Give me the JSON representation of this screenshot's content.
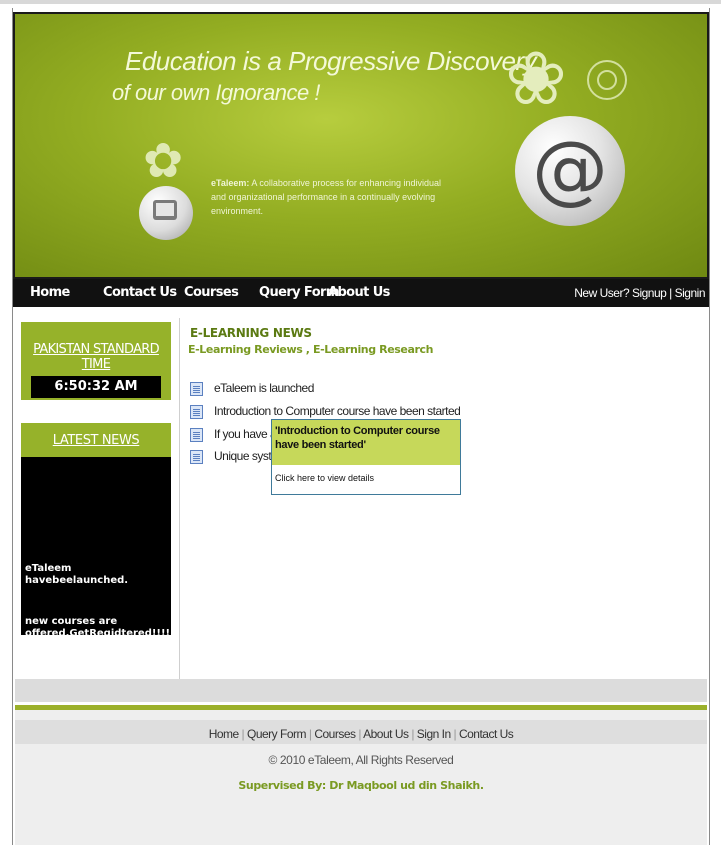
{
  "header": {
    "headline_line1": "Education is a Progressive Discovery",
    "headline_line2": "of our own Ignorance !",
    "brand": "eTaleem:",
    "tagline": "A collaborative process for enhancing individual and organizational performance in a continually evolving environment.",
    "at_symbol": "@"
  },
  "nav": {
    "items": [
      "Home",
      "Contact Us",
      "Courses",
      "Query Form",
      "About Us"
    ],
    "new_user": "New User? Signup",
    "separator": "|",
    "signin": "Signin"
  },
  "sidebar": {
    "clock_title": "PAKISTAN STANDARD TIME",
    "clock_time": "6:50:32 AM",
    "news_title": "LATEST NEWS",
    "news_items": [
      "eTaleem havebeelaunched.",
      "new courses are offered.GetRegidtered!!!!!"
    ]
  },
  "main": {
    "title": "E-LEARNING NEWS",
    "subtitle": "E-Learning Reviews , E-Learning Research",
    "items": [
      "eTaleem is launched",
      "Introduction to Computer course have been started",
      "If you have any",
      "Unique system"
    ]
  },
  "tooltip": {
    "title": "'Introduction to Computer course have been started'",
    "link": "Click here to view details"
  },
  "footer": {
    "links": [
      "Home",
      "Query Form",
      "Courses",
      "About Us",
      "Sign In",
      "Contact Us"
    ],
    "copyright": "© 2010 eTaleem, All Rights Reserved",
    "supervisor": "Supervised By: Dr Maqbool ud din Shaikh."
  },
  "colors": {
    "accent_green": "#96b22a",
    "nav_bg": "#111111",
    "link_green": "#7a9a22"
  }
}
